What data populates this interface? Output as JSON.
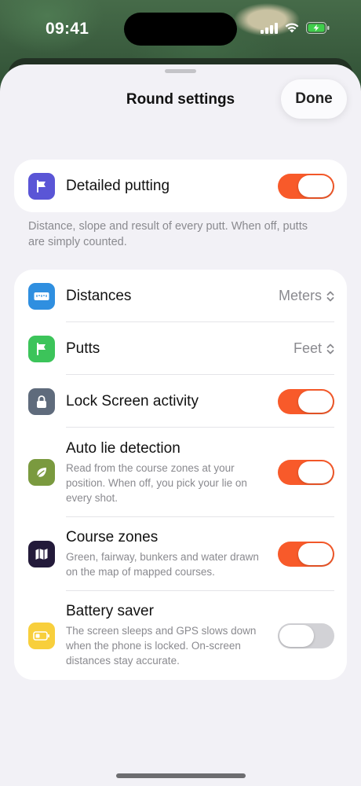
{
  "status_bar": {
    "time": "09:41"
  },
  "sheet": {
    "title": "Round settings",
    "done_label": "Done"
  },
  "putting": {
    "label": "Detailed putting",
    "enabled": true,
    "footnote": "Distance, slope and result of every putt. When off, putts are simply counted."
  },
  "settings": {
    "distances": {
      "label": "Distances",
      "value": "Meters"
    },
    "putts": {
      "label": "Putts",
      "value": "Feet"
    },
    "lock_screen": {
      "label": "Lock Screen activity",
      "enabled": true
    },
    "auto_lie": {
      "label": "Auto lie detection",
      "description": "Read from the course zones at your position. When off, you pick your lie on every shot.",
      "enabled": true
    },
    "course_zones": {
      "label": "Course zones",
      "description": "Green, fairway, bunkers and water drawn on the map of mapped courses.",
      "enabled": true
    },
    "battery_saver": {
      "label": "Battery saver",
      "description": "The screen sleeps and GPS slows down when the phone is locked. On-screen distances stay accurate.",
      "enabled": false
    }
  },
  "colors": {
    "toggle_on": "#f85a2a",
    "putting_icon": "#5a55d6",
    "distances_icon": "#2f8fe0",
    "putts_icon": "#3cc45a",
    "lock_icon": "#5f6b7c",
    "auto_lie_icon": "#7a9a3f",
    "zones_icon": "#231a3a",
    "battery_icon": "#f8cf3c"
  },
  "icons": {
    "putting": "flag-icon",
    "distances": "ruler-icon",
    "putts": "flag-icon",
    "lock_screen": "lock-icon",
    "auto_lie": "leaf-icon",
    "course_zones": "map-icon",
    "battery_saver": "battery-icon"
  }
}
